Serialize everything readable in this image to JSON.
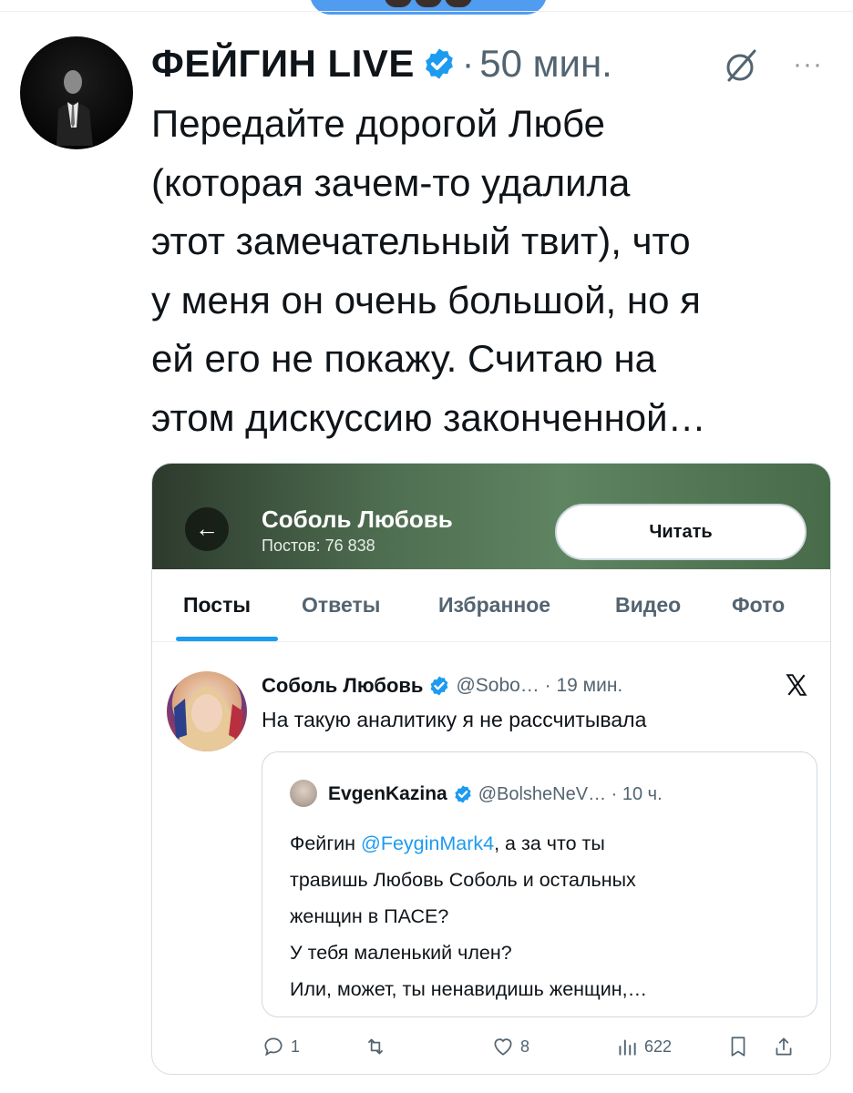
{
  "post": {
    "author_name": "ФЕЙГИН LIVE",
    "separator": "·",
    "time": "50 мин.",
    "more_label": "···",
    "text_lines": [
      "Передайте дорогой Любе",
      "(которая зачем-то удалила",
      "этот замечательный твит), что",
      "у меня он очень большой, но я",
      "ей его не покажу. Считаю на",
      "этом дискуссию законченной…"
    ]
  },
  "screenshot": {
    "profile_name": "Соболь Любовь",
    "posts_count": "Постов: 76 838",
    "follow_label": "Читать",
    "back_icon": "←",
    "tabs": [
      "Посты",
      "Ответы",
      "Избранное",
      "Видео",
      "Фото"
    ],
    "tweet": {
      "name": "Соболь Любовь",
      "meta": "@Sobo… · 19 мин.",
      "text": "На такую аналитику я не рассчитывала",
      "quote": {
        "name": "EvgenKazina",
        "meta": "@BolsheNeV… · 10 ч.",
        "text_line1_prefix": "Фейгин ",
        "mention": "@FeyginMark4",
        "text_line1_suffix": ", а за что ты",
        "text_lines": [
          "травишь Любовь Соболь и остальных",
          "женщин в ПАСЕ?",
          "У тебя маленький член?",
          "Или, может, ты ненавидишь женщин,…"
        ]
      },
      "actions": {
        "replies": "1",
        "likes": "8",
        "views": "622"
      }
    }
  },
  "colors": {
    "accent": "#1d9bf0",
    "secondary_text": "#536471",
    "banner_green": "#4f6f52"
  }
}
